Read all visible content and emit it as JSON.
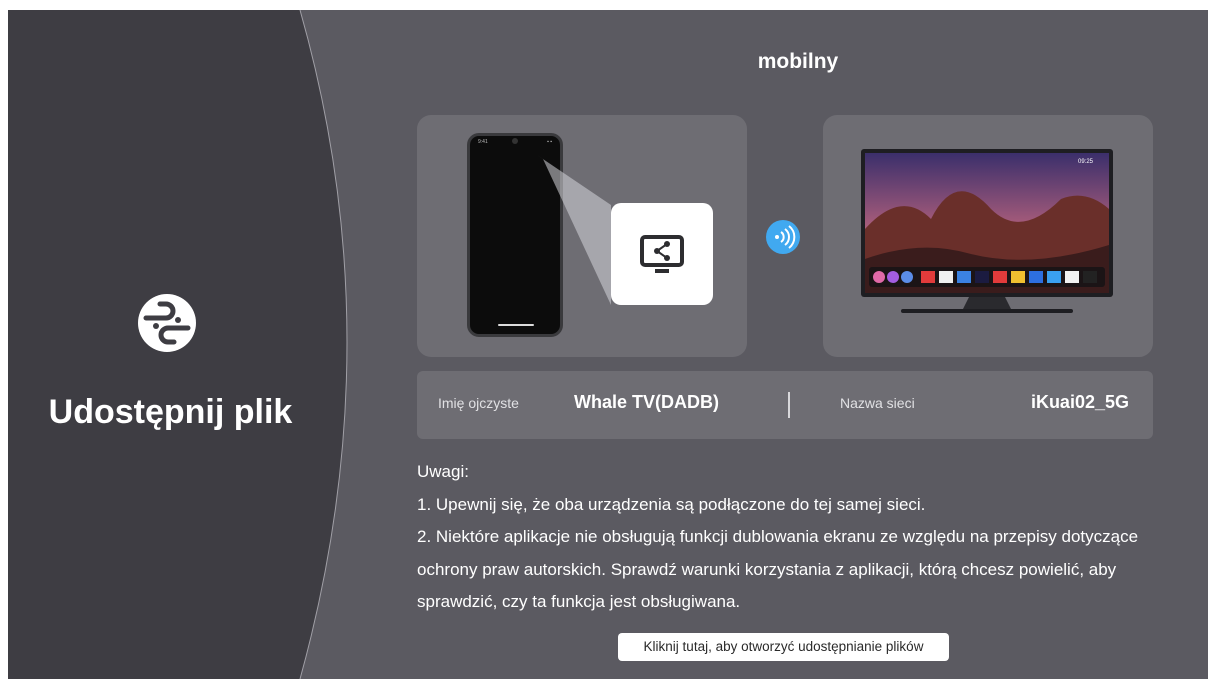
{
  "sidebar": {
    "title": "Udostępnij plik",
    "logo_icon": "link-share-icon"
  },
  "main": {
    "title": "mobilny",
    "phone_card": {
      "phone_status_time": "9:41",
      "share_icon": "screen-share-icon"
    },
    "transfer_icon": "wireless-signal-icon",
    "tv_card": {
      "tv_clock": "09:25"
    },
    "device_info": {
      "device_label": "Imię ojczyste",
      "device_value": "Whale TV(DADB)",
      "network_label": "Nazwa sieci",
      "network_value": "iKuai02_5G"
    },
    "notes": {
      "heading": "Uwagi:",
      "items": [
        "1. Upewnij się, że oba urządzenia są podłączone do tej samej sieci.",
        "2. Niektóre aplikacje nie obsługują funkcji dublowania ekranu ze względu na przepisy dotyczące ochrony praw autorskich. Sprawdź warunki korzystania z aplikacji, którą chcesz powielić, aby sprawdzić, czy ta funkcja jest obsługiwana."
      ]
    },
    "open_button_label": "Kliknij tutaj, aby otworzyć udostępnianie plików"
  },
  "colors": {
    "background": "#5b5a61",
    "left_panel": "#3e3d43",
    "card": "#6e6d73",
    "accent": "#41a9f0"
  }
}
